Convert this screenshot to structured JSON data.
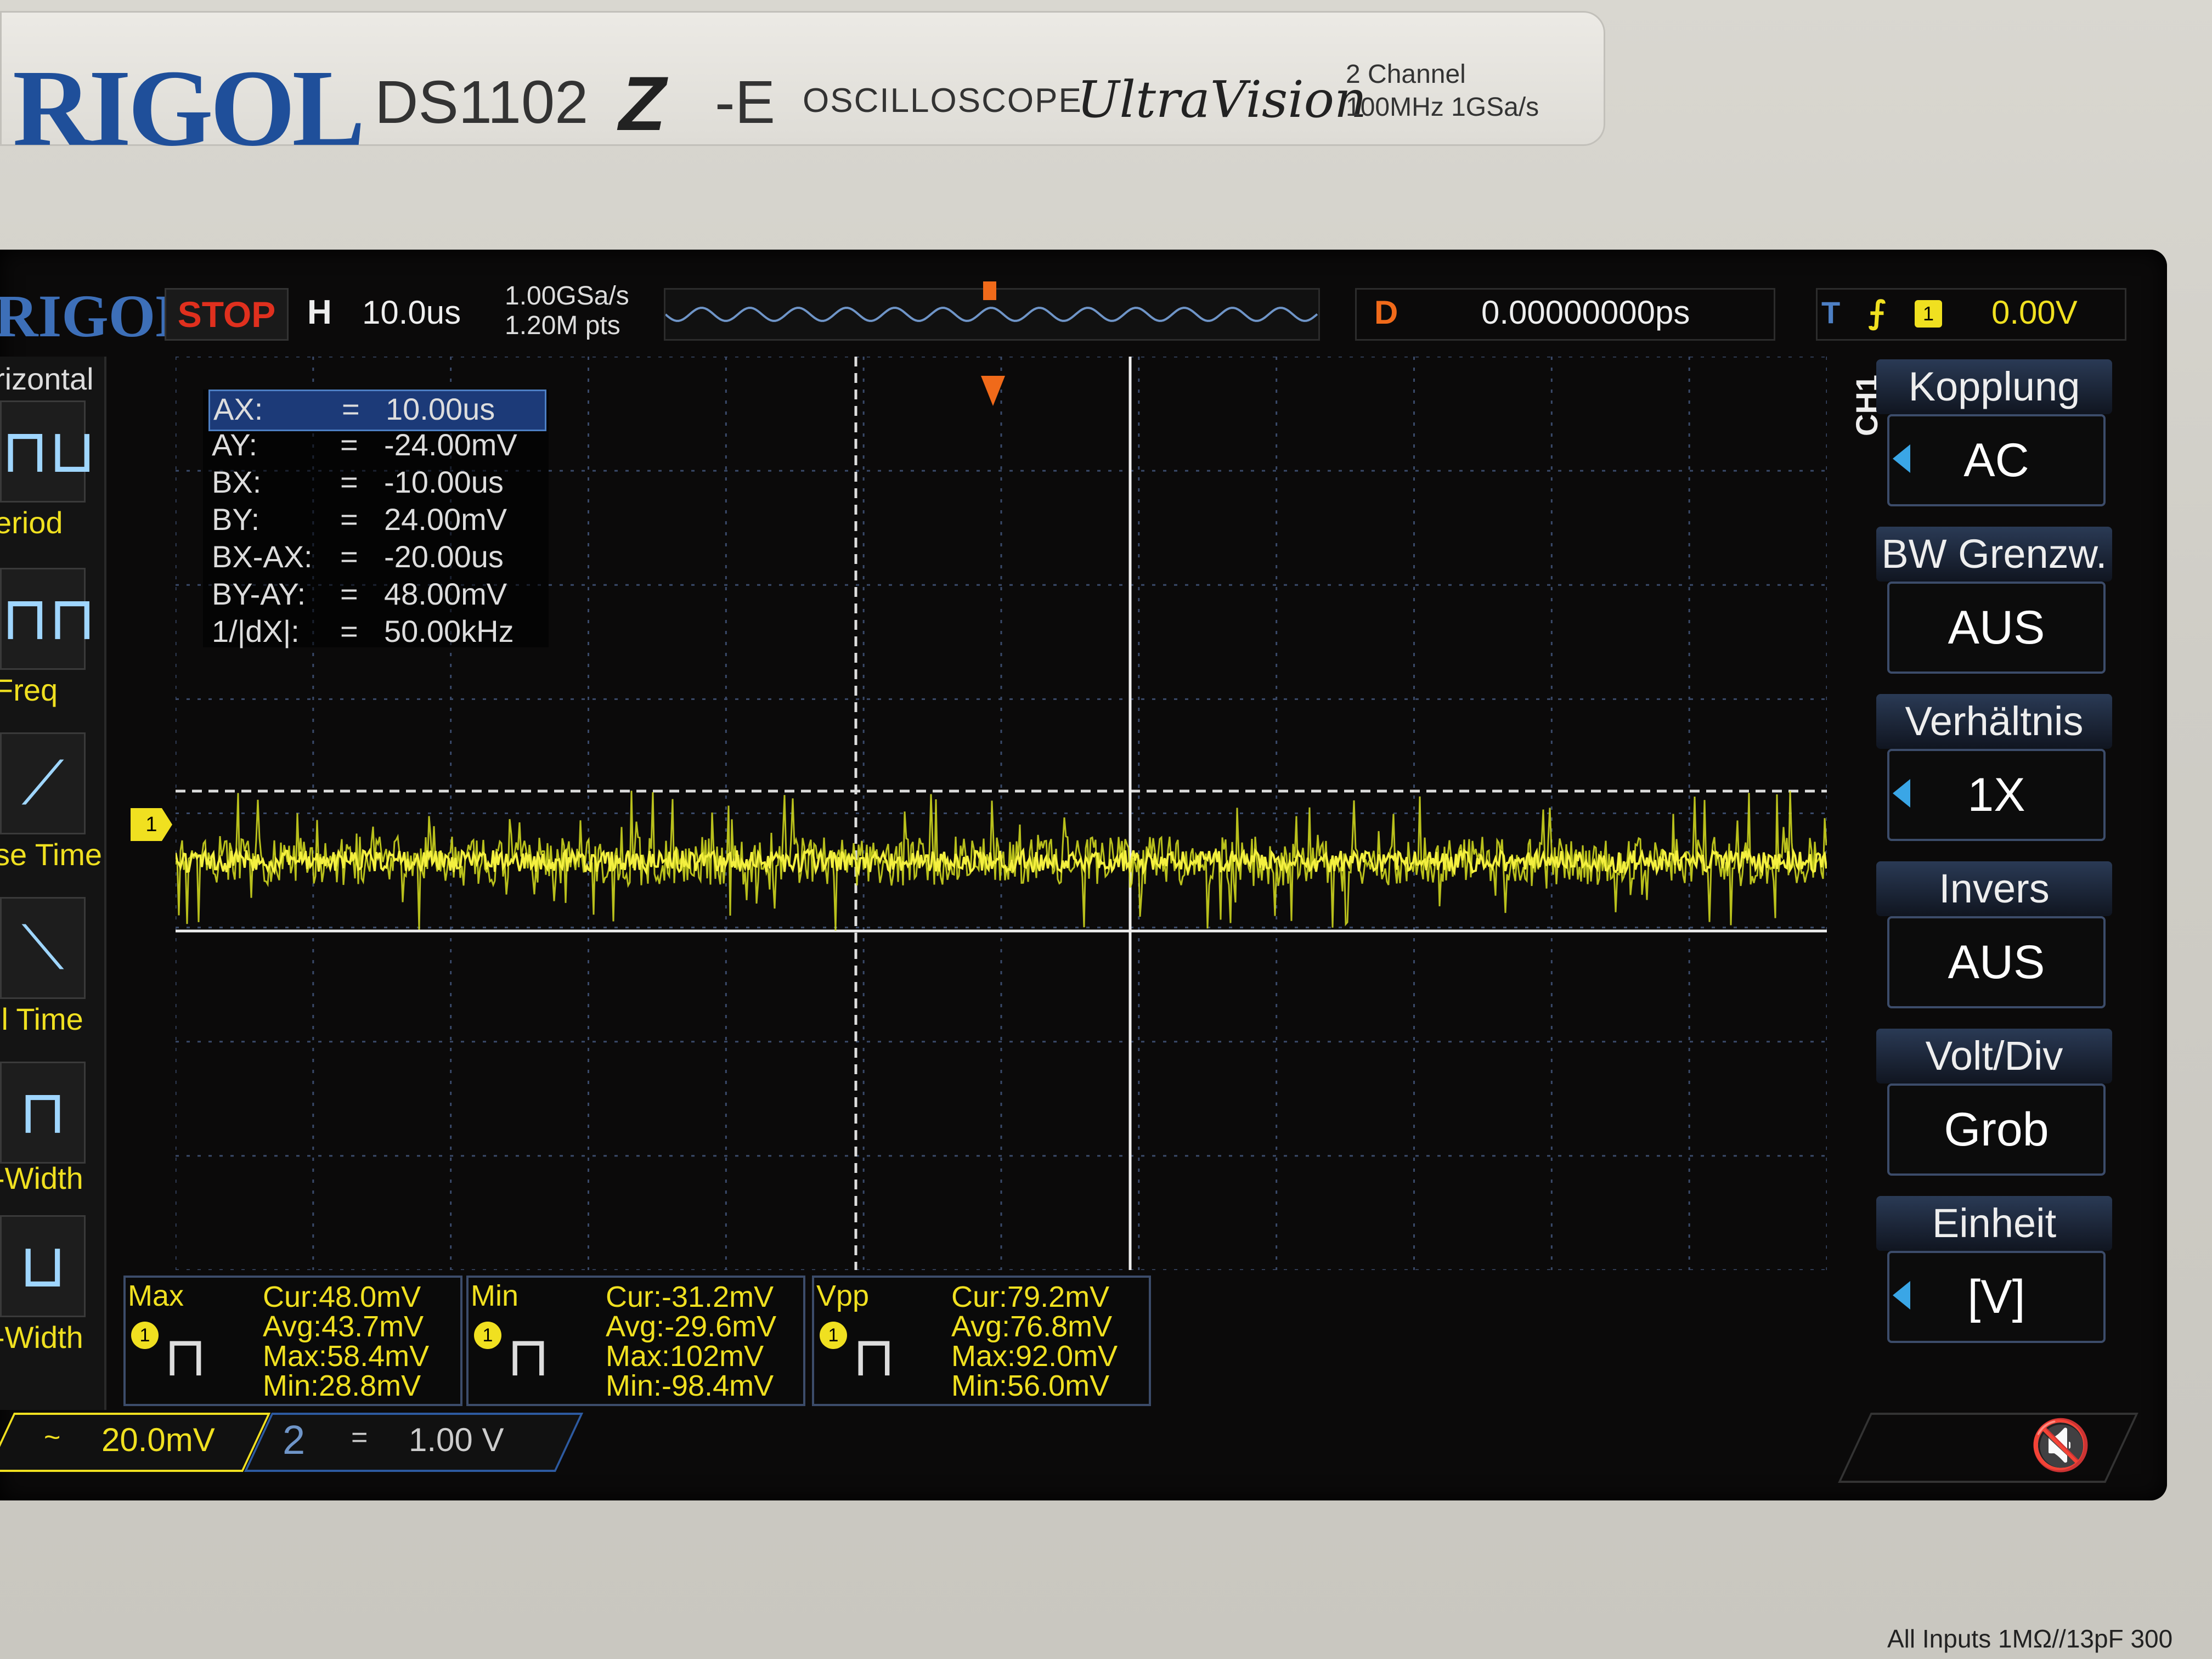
{
  "bezel": {
    "brand": "RIGOL",
    "model": "DS1102",
    "series": "Z",
    "model_suffix": "-E",
    "type": "OSCILLOSCOPE",
    "ultravision": "UltraVision",
    "channels": "2 Channel",
    "spec": "100MHz  1GSa/s",
    "inputs_note": "All Inputs 1MΩ//13pF 300"
  },
  "topbar": {
    "logo": "RIGOL",
    "run_state": "STOP",
    "h_label": "H",
    "timebase": "10.0us",
    "sample_rate": "1.00GSa/s",
    "memory_depth": "1.20M pts",
    "delay_label": "D",
    "delay_value": "0.00000000ps",
    "trigger_label": "T",
    "trigger_edge": "⨍",
    "trigger_channel": "1",
    "trigger_level": "0.00V"
  },
  "left_menu": {
    "header": "rizontal",
    "items": [
      {
        "label": "eriod",
        "icon": "period-icon"
      },
      {
        "label": "Freq",
        "icon": "frequency-icon"
      },
      {
        "label": "se Time",
        "icon": "rise-time-icon"
      },
      {
        "label": "ll Time",
        "icon": "fall-time-icon"
      },
      {
        "label": "-Width",
        "icon": "positive-width-icon"
      },
      {
        "label": "-Width",
        "icon": "negative-width-icon"
      }
    ]
  },
  "cursors": [
    {
      "key": "AX:",
      "eq": "=",
      "value": "10.00us"
    },
    {
      "key": "AY:",
      "eq": "=",
      "value": "-24.00mV"
    },
    {
      "key": "BX:",
      "eq": "=",
      "value": "-10.00us"
    },
    {
      "key": "BY:",
      "eq": "=",
      "value": "24.00mV"
    },
    {
      "key": "BX-AX:",
      "eq": "=",
      "value": "-20.00us"
    },
    {
      "key": "BY-AY:",
      "eq": "=",
      "value": "48.00mV"
    },
    {
      "key": "1/|dX|:",
      "eq": "=",
      "value": "50.00kHz"
    }
  ],
  "channel_marker": "1",
  "right_menu": {
    "channel": "CH1",
    "items": [
      {
        "title": "Kopplung",
        "value": "AC",
        "has_arrow": true
      },
      {
        "title": "BW Grenzw.",
        "value": "AUS",
        "has_arrow": false
      },
      {
        "title": "Verhältnis",
        "value": "1X",
        "has_arrow": true
      },
      {
        "title": "Invers",
        "value": "AUS",
        "has_arrow": false
      },
      {
        "title": "Volt/Div",
        "value": "Grob",
        "has_arrow": false
      },
      {
        "title": "Einheit",
        "value": "[V]",
        "has_arrow": true
      }
    ]
  },
  "measurements": [
    {
      "name": "Max",
      "channel": "1",
      "cur": "Cur:48.0mV",
      "avg": "Avg:43.7mV",
      "max": "Max:58.4mV",
      "min": "Min:28.8mV"
    },
    {
      "name": "Min",
      "channel": "1",
      "cur": "Cur:-31.2mV",
      "avg": "Avg:-29.6mV",
      "max": "Max:102mV",
      "min": "Min:-98.4mV"
    },
    {
      "name": "Vpp",
      "channel": "1",
      "cur": "Cur:79.2mV",
      "avg": "Avg:76.8mV",
      "max": "Max:92.0mV",
      "min": "Min:56.0mV"
    }
  ],
  "bottom": {
    "ch1_coupling": "~",
    "ch1_scale": "20.0mV",
    "ch2_number": "2",
    "ch2_coupling": "=",
    "ch2_scale": "1.00 V"
  },
  "colors": {
    "ch1": "#f0e020",
    "ch2": "#2d5aa0",
    "stop": "#e0301e",
    "delay": "#f06a1a",
    "accent": "#3aa6e6"
  },
  "chart_data": {
    "type": "line",
    "series": [
      {
        "name": "CH1",
        "description_values_mV": {
          "mean": 0,
          "vpp": 79.2
        }
      }
    ],
    "ylabel": "",
    "xlabel": ""
  }
}
